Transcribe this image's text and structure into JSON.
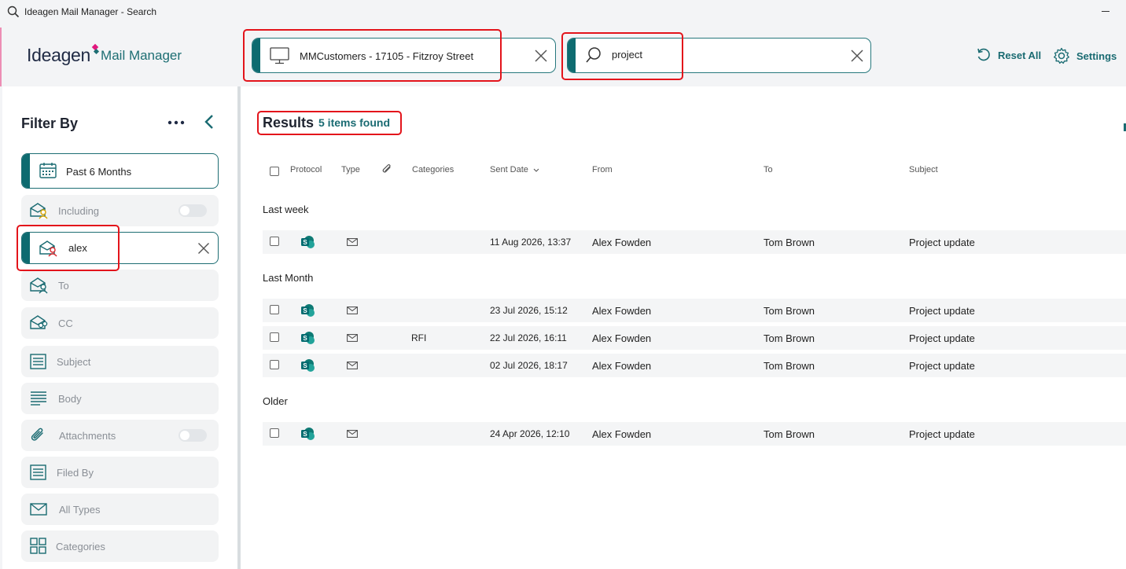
{
  "window": {
    "title": "Ideagen Mail Manager - Search"
  },
  "header": {
    "logo_main": "Ideagen",
    "logo_sub": "Mail Manager",
    "location_chip": "MMCustomers - 17105 - Fitzroy Street",
    "search_value": "project",
    "reset_label": "Reset All",
    "settings_label": "Settings"
  },
  "sidebar": {
    "title": "Filter By",
    "filters": [
      {
        "label": "Past 6 Months",
        "icon": "calendar-icon"
      },
      {
        "label": "Including",
        "icon": "envelope-person-icon"
      },
      {
        "label": "alex",
        "icon": "envelope-person-icon"
      },
      {
        "label": "To",
        "icon": "envelope-people-icon"
      },
      {
        "label": "CC",
        "icon": "envelope-people-icon"
      },
      {
        "label": "Subject",
        "icon": "subject-icon"
      },
      {
        "label": "Body",
        "icon": "body-lines-icon"
      },
      {
        "label": "Attachments",
        "icon": "paperclip-icon"
      },
      {
        "label": "Filed By",
        "icon": "filed-by-icon"
      },
      {
        "label": "All Types",
        "icon": "envelope-icon"
      },
      {
        "label": "Categories",
        "icon": "grid-icon"
      }
    ]
  },
  "results": {
    "title": "Results",
    "count": "5 items found",
    "columns": {
      "protocol": "Protocol",
      "type": "Type",
      "categories": "Categories",
      "sent_date": "Sent Date",
      "from": "From",
      "to": "To",
      "subject": "Subject"
    },
    "groups": [
      {
        "label": "Last week",
        "rows": [
          {
            "category": "",
            "date": "11 Aug 2026, 13:37",
            "from": "Alex Fowden",
            "to": "Tom Brown",
            "subject": "Project update"
          }
        ]
      },
      {
        "label": "Last Month",
        "rows": [
          {
            "category": "",
            "date": "23 Jul 2026, 15:12",
            "from": "Alex Fowden",
            "to": "Tom Brown",
            "subject": "Project update"
          },
          {
            "category": "RFI",
            "date": "22 Jul 2026, 16:11",
            "from": "Alex Fowden",
            "to": "Tom Brown",
            "subject": "Project update"
          },
          {
            "category": "",
            "date": "02 Jul 2026, 18:17",
            "from": "Alex Fowden",
            "to": "Tom Brown",
            "subject": "Project update"
          }
        ]
      },
      {
        "label": "Older",
        "rows": [
          {
            "category": "",
            "date": "24 Apr 2026, 12:10",
            "from": "Alex Fowden",
            "to": "Tom Brown",
            "subject": "Project update"
          }
        ]
      }
    ]
  },
  "colors": {
    "accent": "#0e6b70",
    "accent_text": "#1a6b72",
    "highlight": "#e3141b",
    "row_bg": "#f4f5f6"
  }
}
